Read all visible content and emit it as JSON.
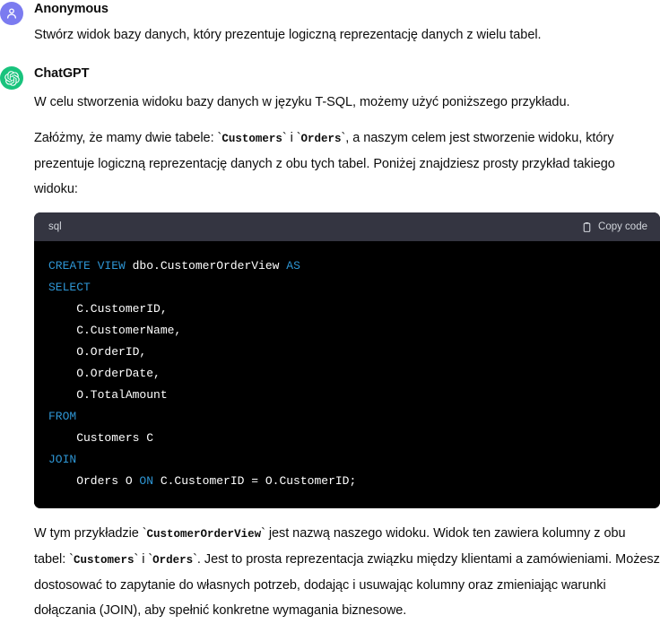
{
  "messages": [
    {
      "author": "Anonymous",
      "avatar_icon": "user-person-icon",
      "text": "Stwórz widok bazy danych, który prezentuje logiczną reprezentację danych z wielu tabel."
    },
    {
      "author": "ChatGPT",
      "avatar_icon": "openai-logo-icon"
    }
  ],
  "assistant": {
    "paragraph_1": "W celu stworzenia widoku bazy danych w języku T-SQL, możemy użyć poniższego przykładu.",
    "paragraph_2_part_1": "Załóżmy, że mamy dwie tabele: `",
    "paragraph_2_code_1": "Customers",
    "paragraph_2_part_2": "` i `",
    "paragraph_2_code_2": "Orders",
    "paragraph_2_part_3": "`, a naszym celem jest stworzenie widoku, który prezentuje logiczną reprezentację danych z obu tych tabel. Poniżej znajdziesz prosty przykład takiego widoku:",
    "paragraph_3_part_1": "W tym przykładzie `",
    "paragraph_3_code_1": "CustomerOrderView",
    "paragraph_3_part_2": "` jest nazwą naszego widoku. Widok ten zawiera kolumny z obu tabel: `",
    "paragraph_3_code_2": "Customers",
    "paragraph_3_part_3": "` i `",
    "paragraph_3_code_3": "Orders",
    "paragraph_3_part_4": "`. Jest to prosta reprezentacja związku między klientami a zamówieniami. Możesz dostosować to zapytanie do własnych potrzeb, dodając i usuwając kolumny oraz zmieniając warunki dołączania (JOIN), aby spełnić konkretne wymagania biznesowe."
  },
  "codeblock": {
    "language": "sql",
    "copy_label": "Copy code",
    "copy_icon": "clipboard-icon",
    "lines": [
      [
        {
          "t": "CREATE VIEW ",
          "c": "kw"
        },
        {
          "t": "dbo.CustomerOrderView ",
          "c": "pl"
        },
        {
          "t": "AS",
          "c": "kw"
        }
      ],
      [
        {
          "t": "SELECT",
          "c": "kw"
        }
      ],
      [
        {
          "t": "    C.CustomerID,",
          "c": "pl"
        }
      ],
      [
        {
          "t": "    C.CustomerName,",
          "c": "pl"
        }
      ],
      [
        {
          "t": "    O.OrderID,",
          "c": "pl"
        }
      ],
      [
        {
          "t": "    O.OrderDate,",
          "c": "pl"
        }
      ],
      [
        {
          "t": "    O.TotalAmount",
          "c": "pl"
        }
      ],
      [
        {
          "t": "FROM",
          "c": "kw"
        }
      ],
      [
        {
          "t": "    Customers C",
          "c": "pl"
        }
      ],
      [
        {
          "t": "JOIN",
          "c": "kw"
        }
      ],
      [
        {
          "t": "    Orders O ",
          "c": "pl"
        },
        {
          "t": "ON",
          "c": "kw"
        },
        {
          "t": " C.CustomerID = O.CustomerID;",
          "c": "pl"
        }
      ]
    ],
    "raw": "CREATE VIEW dbo.CustomerOrderView AS\nSELECT\n    C.CustomerID,\n    C.CustomerName,\n    O.OrderID,\n    O.OrderDate,\n    O.TotalAmount\nFROM\n    Customers C\nJOIN\n    Orders O ON C.CustomerID = O.CustomerID;"
  },
  "colors": {
    "user_avatar": "#7b7bf0",
    "assistant_avatar": "#19c37d",
    "code_header_bg": "#343541",
    "code_body_bg": "#000000",
    "code_keyword": "#2e95d3",
    "page_bg": "#ffffff",
    "text": "#0d0d0d"
  }
}
